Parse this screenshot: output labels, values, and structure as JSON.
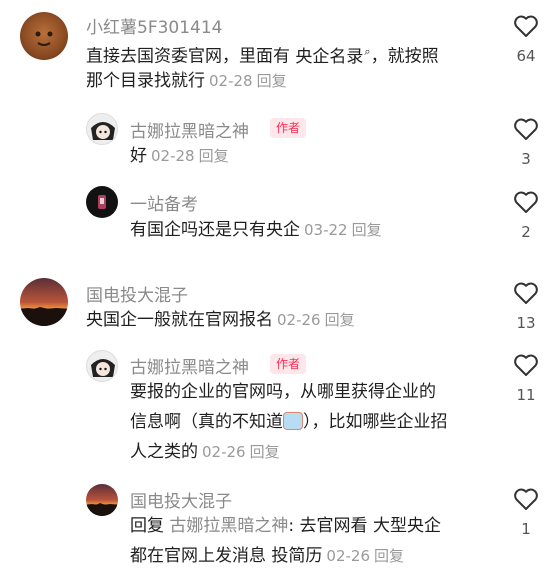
{
  "comments": [
    {
      "user": "小红薯5F301414",
      "lines": [
        "直接去国资委官网，里面有 ",
        "央企名录",
        "，就按照",
        "那个目录找就行"
      ],
      "date": "02-28",
      "reply": "回复",
      "likes": "64",
      "replies": [
        {
          "user": "古娜拉黑暗之神",
          "badge": "作者",
          "lines": [
            "好"
          ],
          "date": "02-28",
          "reply": "回复",
          "likes": "3"
        },
        {
          "user": "一站备考",
          "lines": [
            "有国企吗还是只有央企"
          ],
          "date": "03-22",
          "reply": "回复",
          "likes": "2"
        }
      ]
    },
    {
      "user": "国电投大混子",
      "lines": [
        "央国企一般就在官网报名"
      ],
      "date": "02-26",
      "reply": "回复",
      "likes": "13",
      "replies": [
        {
          "user": "古娜拉黑暗之神",
          "badge": "作者",
          "lines": [
            "要报的企业的官网吗，从哪里获得企业的",
            "信息啊（真的不知道",
            "），比如哪些企业招",
            "人之类的"
          ],
          "date": "02-26",
          "reply": "回复",
          "likes": "11"
        },
        {
          "user": "国电投大混子",
          "reply_prefix": "回复",
          "reply_to": "古娜拉黑暗之神",
          "lines": [
            "去官网看  大型央企",
            "都在官网上发消息  投简历"
          ],
          "date": "02-26",
          "reply": "回复",
          "likes": "1"
        }
      ]
    }
  ],
  "icons": {
    "like": "heart-outline-icon",
    "search": "search-icon",
    "emoji": "crying-emoji-icon"
  }
}
